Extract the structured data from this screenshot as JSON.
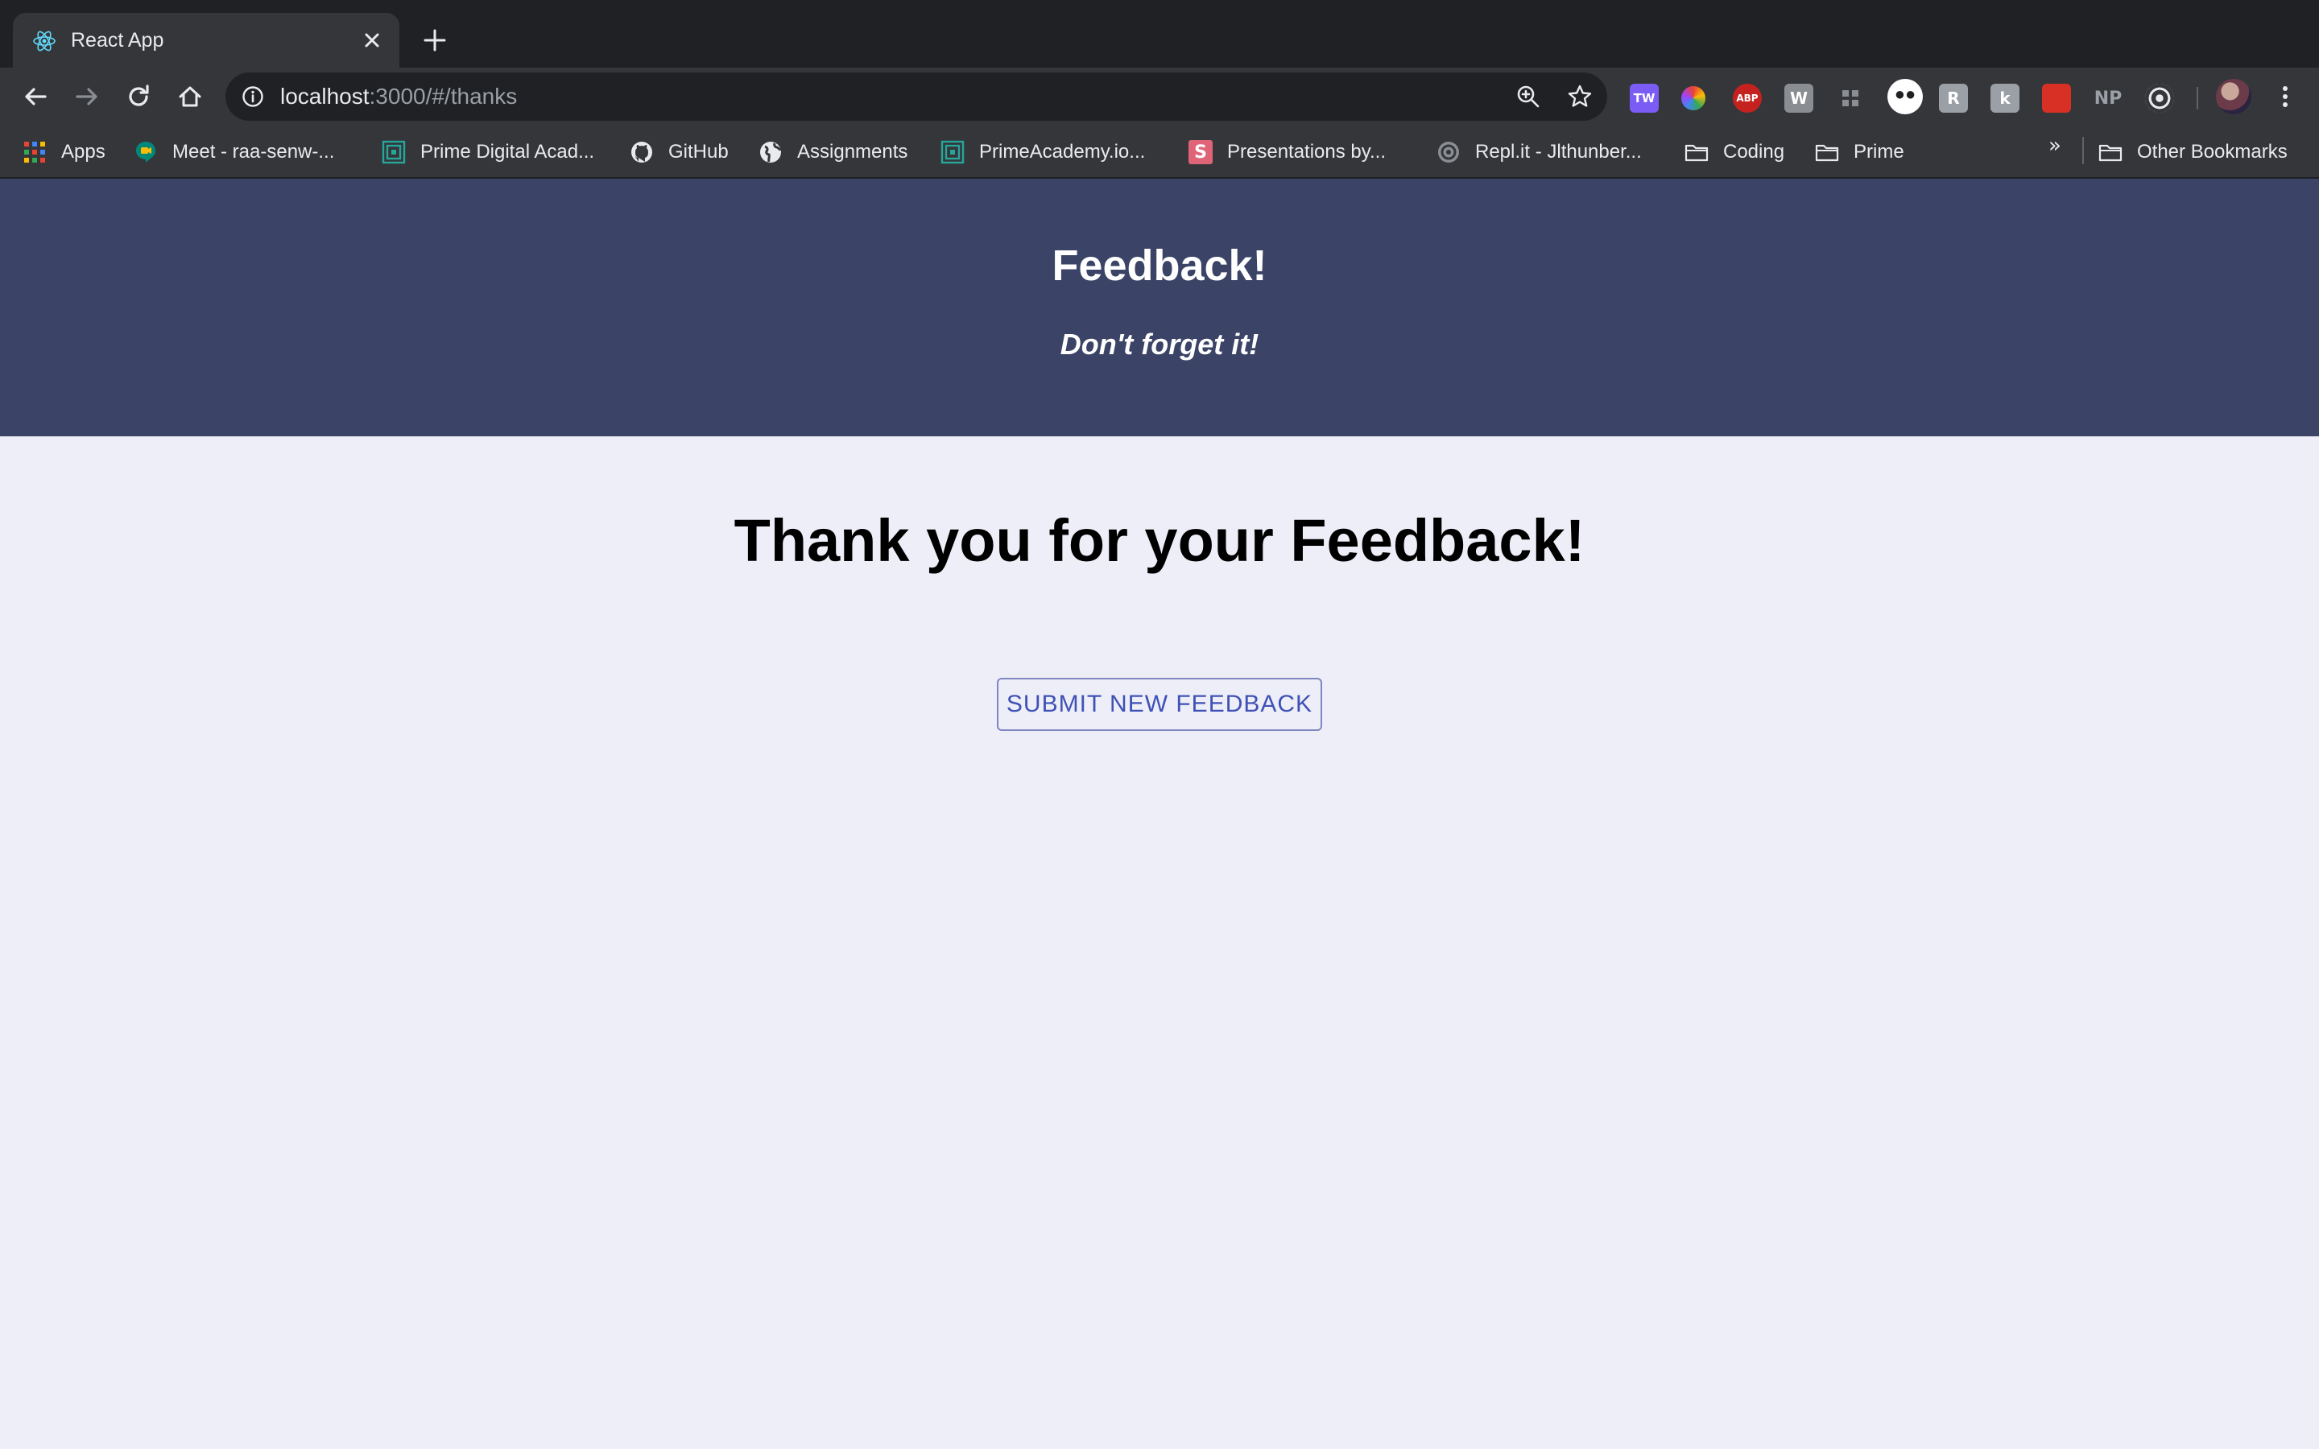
{
  "browser": {
    "tab": {
      "title": "React App",
      "favicon": "react-icon"
    },
    "address": {
      "host": "localhost",
      "rest": ":3000/#/thanks"
    },
    "bookmarks": [
      {
        "label": "Apps",
        "icon": "apps-grid-icon"
      },
      {
        "label": "Meet - raa-senw-...",
        "icon": "google-meet-icon"
      },
      {
        "label": "Prime Digital Acad...",
        "icon": "prime-icon"
      },
      {
        "label": "GitHub",
        "icon": "github-icon"
      },
      {
        "label": "Assignments",
        "icon": "globe-icon"
      },
      {
        "label": "PrimeAcademy.io...",
        "icon": "prime-icon"
      },
      {
        "label": "Presentations by...",
        "icon": "slides-icon",
        "badge": "S"
      },
      {
        "label": "Repl.it - Jlthunber...",
        "icon": "replit-icon"
      },
      {
        "label": "Coding",
        "icon": "folder-icon"
      },
      {
        "label": "Prime",
        "icon": "folder-icon"
      }
    ],
    "more_bookmarks": "»",
    "other_bookmarks": "Other Bookmarks",
    "extensions": [
      {
        "name": "tw-extension-icon",
        "text": "TW",
        "color": "#7b5cf5"
      },
      {
        "name": "color-wheel-extension-icon",
        "text": "",
        "color": "#35363a"
      },
      {
        "name": "adblock-plus-icon",
        "text": "ABP",
        "color": "#c5221f"
      },
      {
        "name": "w-extension-icon",
        "text": "W",
        "color": "#8a8d91"
      },
      {
        "name": "grid-extension-icon",
        "text": "",
        "color": "#35363a"
      },
      {
        "name": "face-extension-icon",
        "text": "",
        "color": "#ffffff"
      },
      {
        "name": "r-extension-icon",
        "text": "R",
        "color": "#9aa0a6"
      },
      {
        "name": "k-extension-icon",
        "text": "k",
        "color": "#9aa0a6"
      },
      {
        "name": "red-extension-icon",
        "text": "",
        "color": "#d93025"
      },
      {
        "name": "np-extension-icon",
        "text": "NP",
        "color": "#35363a"
      },
      {
        "name": "target-extension-icon",
        "text": "",
        "color": "#35363a"
      }
    ]
  },
  "page": {
    "header_title": "Feedback!",
    "header_subtitle": "Don't forget it!",
    "heading": "Thank you for your Feedback!",
    "submit_button": "SUBMIT NEW FEEDBACK"
  },
  "colors": {
    "header_bg": "#3b4466",
    "page_bg": "#eeeef8",
    "button_text": "#3f51b5"
  }
}
